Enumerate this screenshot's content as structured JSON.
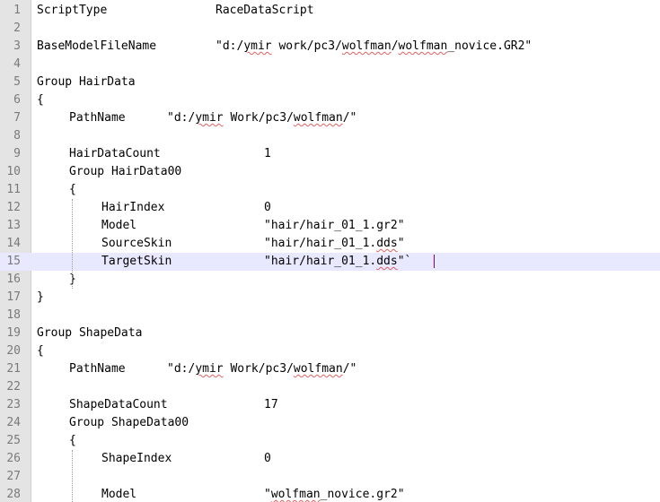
{
  "editor": {
    "current_line": 15,
    "lines": [
      {
        "n": "1",
        "tokens": [
          {
            "t": "ScriptType",
            "c": 0
          },
          {
            "t": "RaceDataScript",
            "c": 199
          }
        ]
      },
      {
        "n": "2",
        "tokens": []
      },
      {
        "n": "3",
        "tokens": [
          {
            "t": "BaseModelFileName",
            "c": 0
          },
          {
            "t": "\"d:/ymir work/pc3/wolfman/wolfman_novice.GR2\"",
            "c": 199
          }
        ]
      },
      {
        "n": "4",
        "tokens": []
      },
      {
        "n": "5",
        "tokens": [
          {
            "t": "Group HairData",
            "c": 0
          }
        ]
      },
      {
        "n": "6",
        "tokens": [
          {
            "t": "{",
            "c": 0
          }
        ]
      },
      {
        "n": "7",
        "tokens": [
          {
            "t": "PathName",
            "c": 36
          },
          {
            "t": "\"d:/ymir Work/pc3/wolfman/\"",
            "c": 145
          }
        ]
      },
      {
        "n": "8",
        "tokens": []
      },
      {
        "n": "9",
        "tokens": [
          {
            "t": "HairDataCount",
            "c": 36
          },
          {
            "t": "1",
            "c": 253
          }
        ]
      },
      {
        "n": "10",
        "tokens": [
          {
            "t": "Group HairData00",
            "c": 36
          }
        ]
      },
      {
        "n": "11",
        "tokens": [
          {
            "t": "{",
            "c": 36
          }
        ]
      },
      {
        "n": "12",
        "tokens": [
          {
            "t": "HairIndex",
            "c": 72
          },
          {
            "t": "0",
            "c": 253
          }
        ]
      },
      {
        "n": "13",
        "tokens": [
          {
            "t": "Model",
            "c": 72
          },
          {
            "t": "\"hair/hair_01_1.gr2\"",
            "c": 253
          }
        ]
      },
      {
        "n": "14",
        "tokens": [
          {
            "t": "SourceSkin",
            "c": 72
          },
          {
            "t": "\"hair/hair_01_1.dds\"",
            "c": 253
          }
        ]
      },
      {
        "n": "15",
        "tokens": [
          {
            "t": "TargetSkin",
            "c": 72
          },
          {
            "t": "\"hair/hair_01_1.dds\"`",
            "c": 253
          }
        ]
      },
      {
        "n": "16",
        "tokens": [
          {
            "t": "}",
            "c": 36
          }
        ]
      },
      {
        "n": "17",
        "tokens": [
          {
            "t": "}",
            "c": 0
          }
        ]
      },
      {
        "n": "18",
        "tokens": []
      },
      {
        "n": "19",
        "tokens": [
          {
            "t": "Group ShapeData",
            "c": 0
          }
        ]
      },
      {
        "n": "20",
        "tokens": [
          {
            "t": "{",
            "c": 0
          }
        ]
      },
      {
        "n": "21",
        "tokens": [
          {
            "t": "PathName",
            "c": 36
          },
          {
            "t": "\"d:/ymir Work/pc3/wolfman/\"",
            "c": 145
          }
        ]
      },
      {
        "n": "22",
        "tokens": []
      },
      {
        "n": "23",
        "tokens": [
          {
            "t": "ShapeDataCount",
            "c": 36
          },
          {
            "t": "17",
            "c": 253
          }
        ]
      },
      {
        "n": "24",
        "tokens": [
          {
            "t": "Group ShapeData00",
            "c": 36
          }
        ]
      },
      {
        "n": "25",
        "tokens": [
          {
            "t": "{",
            "c": 36
          }
        ]
      },
      {
        "n": "26",
        "tokens": [
          {
            "t": "ShapeIndex",
            "c": 72
          },
          {
            "t": "0",
            "c": 253
          }
        ]
      },
      {
        "n": "27",
        "tokens": []
      },
      {
        "n": "28",
        "tokens": [
          {
            "t": "Model",
            "c": 72
          },
          {
            "t": "\"wolfman_novice.gr2\"",
            "c": 253
          }
        ]
      }
    ]
  }
}
